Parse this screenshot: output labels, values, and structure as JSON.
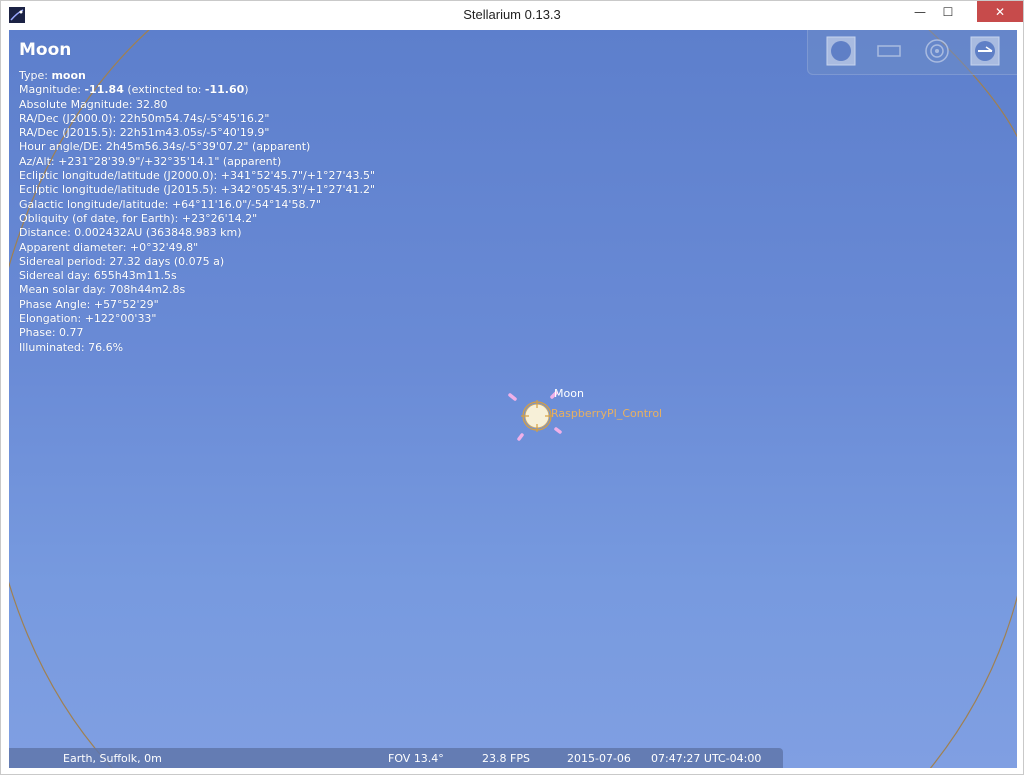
{
  "window": {
    "title": "Stellarium 0.13.3",
    "minimize_glyph": "—",
    "maximize_glyph": "☐",
    "close_glyph": "✕"
  },
  "info": {
    "name": "Moon",
    "type_label": "Type: ",
    "type_value": "moon",
    "magnitude_label": "Magnitude: ",
    "magnitude_value": "-11.84",
    "extincted_label": " (extincted to: ",
    "extincted_value": "-11.60",
    "extincted_close": ")",
    "lines": [
      "Absolute Magnitude: 32.80",
      "RA/Dec (J2000.0): 22h50m54.74s/-5°45'16.2\"",
      "RA/Dec (J2015.5): 22h51m43.05s/-5°40'19.9\"",
      "Hour angle/DE: 2h45m56.34s/-5°39'07.2\" (apparent)",
      "Az/Alt: +231°28'39.9\"/+32°35'14.1\" (apparent)",
      "Ecliptic longitude/latitude (J2000.0): +341°52'45.7\"/+1°27'43.5\"",
      "Ecliptic longitude/latitude (J2015.5): +342°05'45.3\"/+1°27'41.2\"",
      "Galactic longitude/latitude: +64°11'16.0\"/-54°14'58.7\"",
      "Obliquity (of date, for Earth): +23°26'14.2\"",
      "Distance: 0.002432AU (363848.983 km)",
      "Apparent diameter: +0°32'49.8\"",
      "Sidereal period: 27.32 days (0.075 a)",
      "Sidereal day: 655h43m11.5s",
      "Mean solar day: 708h44m2.8s",
      "Phase Angle: +57°52'29\"",
      "Elongation: +122°00'33\"",
      "Phase: 0.77",
      "Illuminated: 76.6%"
    ]
  },
  "sky": {
    "moon_label": "Moon",
    "telescope_label": "RaspberryPI_Control"
  },
  "status": {
    "location": "Earth, Suffolk, 0m",
    "fov": "FOV 13.4°",
    "fps": "23.8 FPS",
    "date": "2015-07-06",
    "time": "07:47:27 UTC-04:00"
  },
  "colors": {
    "sky_top": "#5d7fcc",
    "sky_bottom": "#809fe2",
    "telescope_label": "#e8b060",
    "circle_line": "#a08050",
    "pointer": "#f0b0e8",
    "close_button": "#c74b4b"
  },
  "icons": {
    "app": "stellarium-app-icon",
    "tools": [
      "telescope-slew-icon",
      "ccd-frame-icon",
      "ocular-icon",
      "telrad-icon"
    ]
  }
}
